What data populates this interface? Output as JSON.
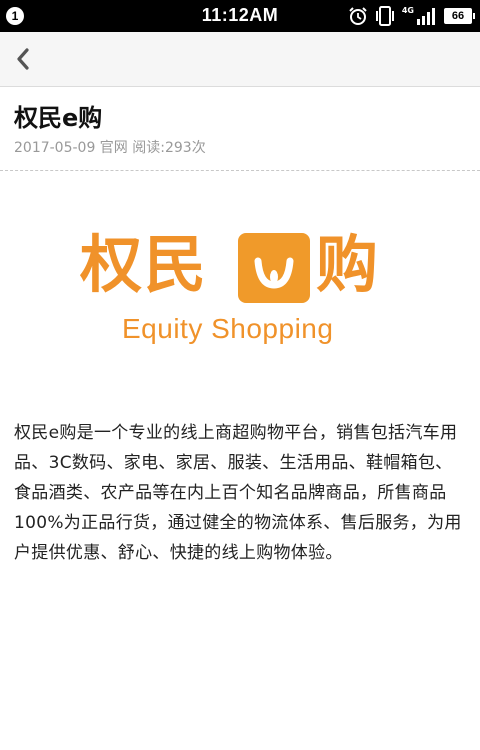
{
  "status_bar": {
    "notification_count": "1",
    "time": "11:12AM",
    "network": "4G",
    "battery": "66",
    "icons": [
      "alarm-icon",
      "vibrate-icon",
      "signal-icon",
      "battery-icon"
    ]
  },
  "app_bar": {
    "back_icon": "chevron-left-icon"
  },
  "article": {
    "title": "权民e购",
    "meta": "2017-05-09 官网 阅读:293次",
    "logo": {
      "chinese_left": "权民",
      "chinese_right": "购",
      "english": "Equity Shopping",
      "color": "#f0922a"
    },
    "body": "权民e购是一个专业的线上商超购物平台，销售包括汽车用品、3C数码、家电、家居、服装、生活用品、鞋帽箱包、食品酒类、农产品等在内上百个知名品牌商品，所售商品100%为正品行货，通过健全的物流体系、售后服务，为用户提供优惠、舒心、快捷的线上购物体验。"
  }
}
